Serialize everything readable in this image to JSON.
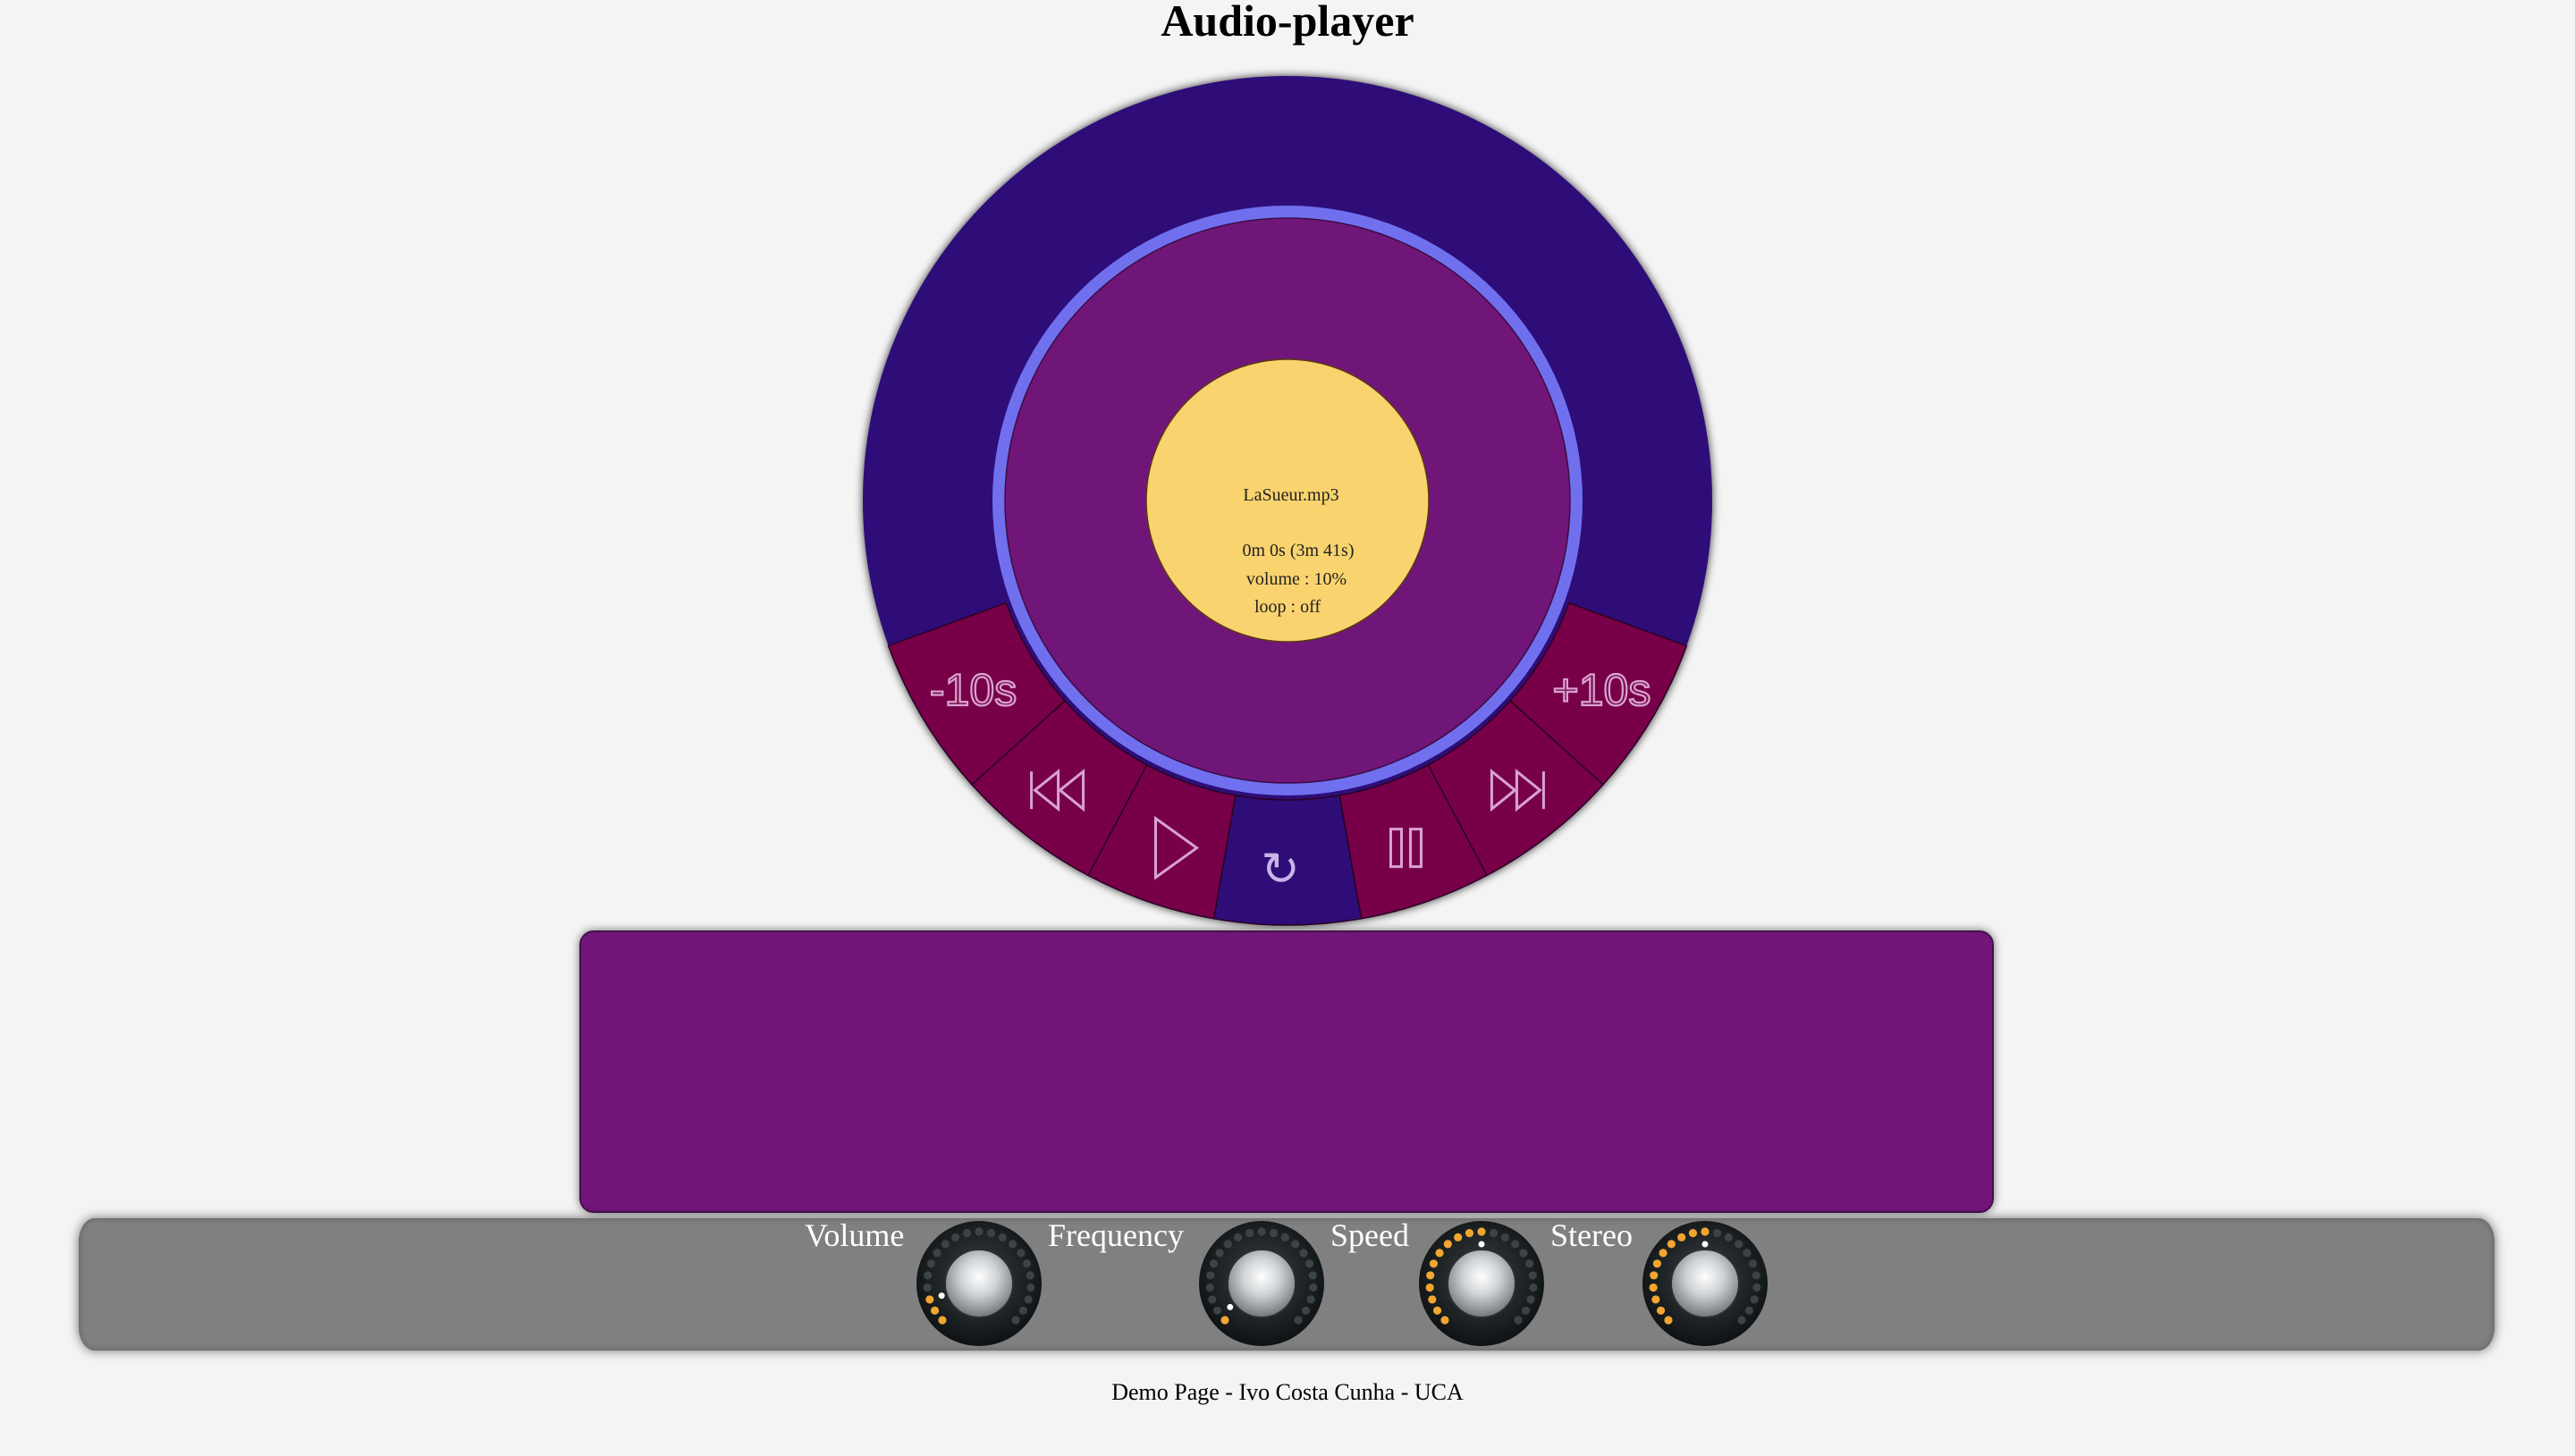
{
  "title": "Audio-player",
  "player": {
    "colors": {
      "outer_ring": "#2e0a78",
      "inner_disc": "#711579",
      "progress_ring": "#6f6fef",
      "center": "#f9d36e",
      "button_segment": "#77044a",
      "active_segment": "#2e0a78",
      "button_glyph": "#d9a2cf"
    },
    "info": {
      "filename": "LaSueur.mp3",
      "time": "0m 0s (3m 41s)",
      "volume": "volume : 10%",
      "loop": "loop : off"
    },
    "buttons": [
      {
        "id": "rewind",
        "label": "-10s",
        "icon": "text"
      },
      {
        "id": "previous",
        "label": "",
        "icon": "skip-back-icon"
      },
      {
        "id": "play",
        "label": "",
        "icon": "play-icon"
      },
      {
        "id": "loop",
        "label": "",
        "icon": "loop-icon",
        "glyph": "↻"
      },
      {
        "id": "pause",
        "label": "",
        "icon": "pause-icon"
      },
      {
        "id": "next",
        "label": "",
        "icon": "skip-forward-icon"
      },
      {
        "id": "forward",
        "label": "+10s",
        "icon": "text"
      }
    ]
  },
  "knobs": [
    {
      "label": "Volume",
      "level": 0.1
    },
    {
      "label": "Frequency",
      "level": 0.03
    },
    {
      "label": "Speed",
      "level": 0.5
    },
    {
      "label": "Stereo",
      "level": 0.5
    }
  ],
  "footer": "Demo Page - Ivo Costa Cunha - UCA"
}
